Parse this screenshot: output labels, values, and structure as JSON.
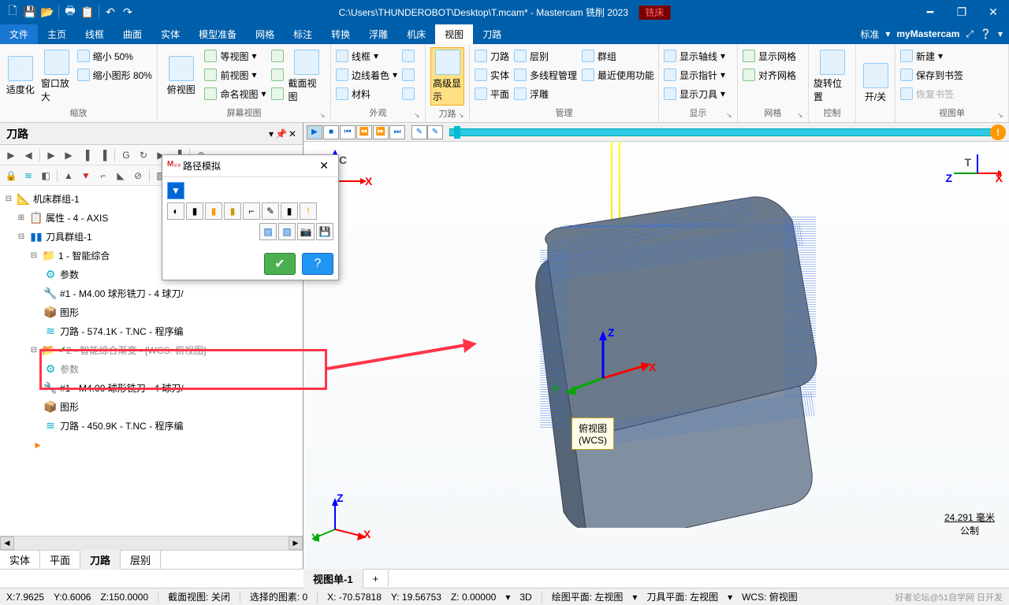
{
  "title": "C:\\Users\\THUNDEROBOT\\Desktop\\T.mcam* - Mastercam 铣削 2023",
  "context_tab": "铣床",
  "menu": {
    "file": "文件",
    "items": [
      "主页",
      "线框",
      "曲面",
      "实体",
      "模型准备",
      "网格",
      "标注",
      "转换",
      "浮雕",
      "机床",
      "视图",
      "刀路"
    ],
    "active": "视图",
    "standard": "标准",
    "brand": "myMastercam"
  },
  "ribbon": {
    "zoom": {
      "label": "缩放",
      "fit": "适度化",
      "window": "窗口放大",
      "shrink50": "缩小 50%",
      "shrinkimg": "缩小图形 80%"
    },
    "screen": {
      "label": "屏幕视图",
      "top": "俯视图",
      "iso": "等视图",
      "front": "前视图",
      "named": "命名视图",
      "section": "截面视图"
    },
    "appearance": {
      "label": "外观",
      "wire": "线框",
      "edge": "边线着色",
      "mat": "材料"
    },
    "toolpath": {
      "label": "刀路",
      "adv": "高级显示"
    },
    "manage": {
      "label": "管理",
      "tp": "刀路",
      "lvl": "层别",
      "grp": "群组",
      "solid": "实体",
      "mt": "多线程管理",
      "recent": "最近使用功能",
      "plane": "平面",
      "relief": "浮雕"
    },
    "display": {
      "label": "显示",
      "axis": "显示轴线",
      "ptr": "显示指针",
      "tool": "显示刀具"
    },
    "grid": {
      "label": "网格",
      "show": "显示网格",
      "align": "对齐网格"
    },
    "control": {
      "label": "控制",
      "rot": "旋转位置"
    },
    "onoff": {
      "label": "",
      "btn": "开/关"
    },
    "viewmenu": {
      "label": "视图单",
      "new": "新建",
      "save": "保存到书签",
      "restore": "恢复书签"
    }
  },
  "panel": {
    "title": "刀路"
  },
  "tree": {
    "root": "机床群组-1",
    "props": "属性 - 4 - AXIS",
    "toolgroup": "刀具群组-1",
    "op1": {
      "name": "1 - 智能综合",
      "params": "参数",
      "tool": "#1 - M4.00 球形铣刀 - 4 球刀/",
      "geom": "图形",
      "tp": "刀路 - 574.1K - T.NC - 程序编"
    },
    "op2": {
      "name": "2 - 智能综合渐变 - [WCS: 俯视图]",
      "params": "参数",
      "tool": "#1 - M4.00 球形铣刀 - 4 球刀/",
      "geom": "图形",
      "tp": "刀路 - 450.9K - T.NC - 程序编"
    }
  },
  "bottom_tabs": [
    "实体",
    "平面",
    "刀路",
    "层别"
  ],
  "bottom_active": "刀路",
  "dialog": {
    "title": "路径模拟"
  },
  "wcs": {
    "l1": "俯视图",
    "l2": "(WCS)"
  },
  "ruler": {
    "dist": "24.291 毫米",
    "unit": "公制"
  },
  "vp_tab": "视图单-1",
  "status": {
    "x": "X:7.9625",
    "y": "Y:0.6006",
    "z": "Z:150.0000",
    "section": "截面视图: 关闭",
    "sel": "选择的图素: 0",
    "vx": "X:   -70.57818",
    "vy": "Y:    19.56753",
    "vz": "Z:   0.00000",
    "mode": "3D",
    "draw": "绘图平面: 左视图",
    "toolp": "刀具平面: 左视图",
    "wcs": "WCS: 俯视图"
  },
  "watermark": "好者论坛@51自学网 日开发",
  "axes": {
    "x": "X",
    "y": "Y",
    "z": "Z",
    "c": "C",
    "t": "T"
  }
}
